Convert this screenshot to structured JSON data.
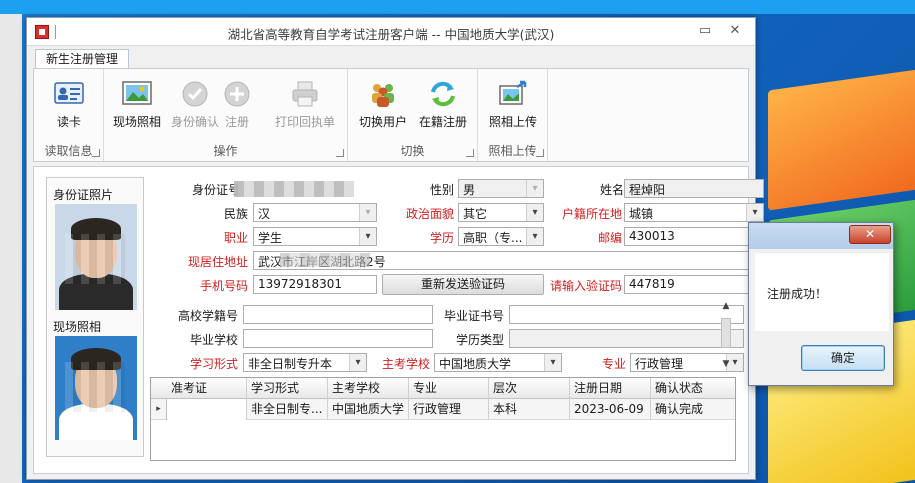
{
  "window": {
    "title": "湖北省高等教育自学考试注册客户端 -- 中国地质大学(武汉)",
    "minimize": "▭",
    "close": "✕"
  },
  "tabs": [
    {
      "label": "新生注册管理"
    }
  ],
  "ribbon": {
    "groups": [
      {
        "label": "读取信息",
        "buttons": [
          {
            "label": "读卡",
            "icon": "id-card-icon"
          }
        ]
      },
      {
        "label": "操作",
        "buttons": [
          {
            "label": "现场照相",
            "icon": "photo-icon"
          },
          {
            "label": "身份确认",
            "icon": "check-circle-icon"
          },
          {
            "label": "注册",
            "icon": "plus-circle-icon"
          },
          {
            "label": "打印回执单",
            "icon": "printer-icon"
          }
        ]
      },
      {
        "label": "切换",
        "buttons": [
          {
            "label": "切换用户",
            "icon": "users-icon"
          },
          {
            "label": "在籍注册",
            "icon": "refresh-icon"
          }
        ]
      },
      {
        "label": "照相上传",
        "buttons": [
          {
            "label": "照相上传",
            "icon": "photo-upload-icon"
          }
        ]
      }
    ]
  },
  "photos": {
    "id_label": "身份证照片",
    "live_label": "现场照相"
  },
  "form": {
    "id_number_label": "身份证号",
    "gender_label": "性别",
    "gender_value": "男",
    "name_label": "姓名",
    "name_value": "程焯阳",
    "ethnicity_label": "民族",
    "ethnicity_value": "汉",
    "political_label": "政治面貌",
    "political_value": "其它",
    "household_label": "户籍所在地",
    "household_value": "城镇",
    "occupation_label": "职业",
    "occupation_value": "学生",
    "education_label": "学历",
    "education_value": "高职（专...",
    "postcode_label": "邮编",
    "postcode_value": "430013",
    "address_label": "现居住地址",
    "address_value": "武汉市江岸区湖北路2号",
    "phone_label": "手机号码",
    "phone_value": "13972918301",
    "resend_button": "重新发送验证码",
    "verify_label": "请输入验证码",
    "verify_value": "447819",
    "school_id_label": "高校学籍号",
    "cert_no_label": "毕业证书号",
    "grad_school_label": "毕业学校",
    "edu_type_label": "学历类型",
    "study_form_label": "学习形式",
    "study_form_value": "非全日制专升本",
    "main_school_label": "主考学校",
    "main_school_value": "中国地质大学",
    "major_label": "专业",
    "major_value": "行政管理"
  },
  "table": {
    "columns": [
      "准考证",
      "学习形式",
      "主考学校",
      "专业",
      "层次",
      "注册日期",
      "确认状态"
    ],
    "rows": [
      [
        "",
        "非全日制专...",
        "中国地质大学",
        "行政管理",
        "本科",
        "2023-06-09",
        "确认完成"
      ]
    ]
  },
  "dialog": {
    "close": "✕",
    "message": "注册成功！",
    "ok_button": "确定"
  },
  "colors": {
    "accent": "#1ea0f0",
    "required_label": "#d21f1f"
  }
}
